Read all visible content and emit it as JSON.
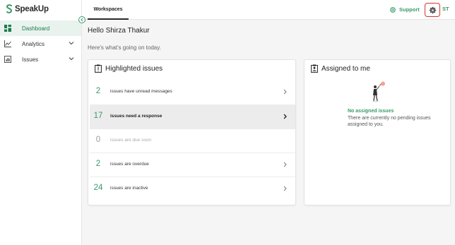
{
  "app": {
    "logo_text": "SpeakUp"
  },
  "sidebar": {
    "items": [
      {
        "label": "Dashboard",
        "icon": "dashboard-icon",
        "active": true
      },
      {
        "label": "Analytics",
        "icon": "analytics-icon",
        "expandable": true
      },
      {
        "label": "Issues",
        "icon": "issues-icon",
        "expandable": true
      }
    ]
  },
  "header": {
    "tab_label": "Workspaces",
    "support_label": "Support",
    "avatar_initials": "ST"
  },
  "main": {
    "greeting": "Hello Shirza Thakur",
    "subgreeting": "Here's what's going on today."
  },
  "highlighted_issues": {
    "title": "Highlighted issues",
    "rows": [
      {
        "count": "2",
        "text": "issues have unread messages"
      },
      {
        "count": "17",
        "text": "issues need a response"
      },
      {
        "count": "0",
        "text": "issues are due soon"
      },
      {
        "count": "2",
        "text": "issues are overdue"
      },
      {
        "count": "24",
        "text": "issues are inactive"
      }
    ]
  },
  "assigned": {
    "title": "Assigned to me",
    "empty_title": "No assigned issues",
    "empty_desc": "There are currently no pending issues assigned to you."
  },
  "colors": {
    "accent": "#3a9a6a",
    "highlight_border": "#d9342b"
  }
}
